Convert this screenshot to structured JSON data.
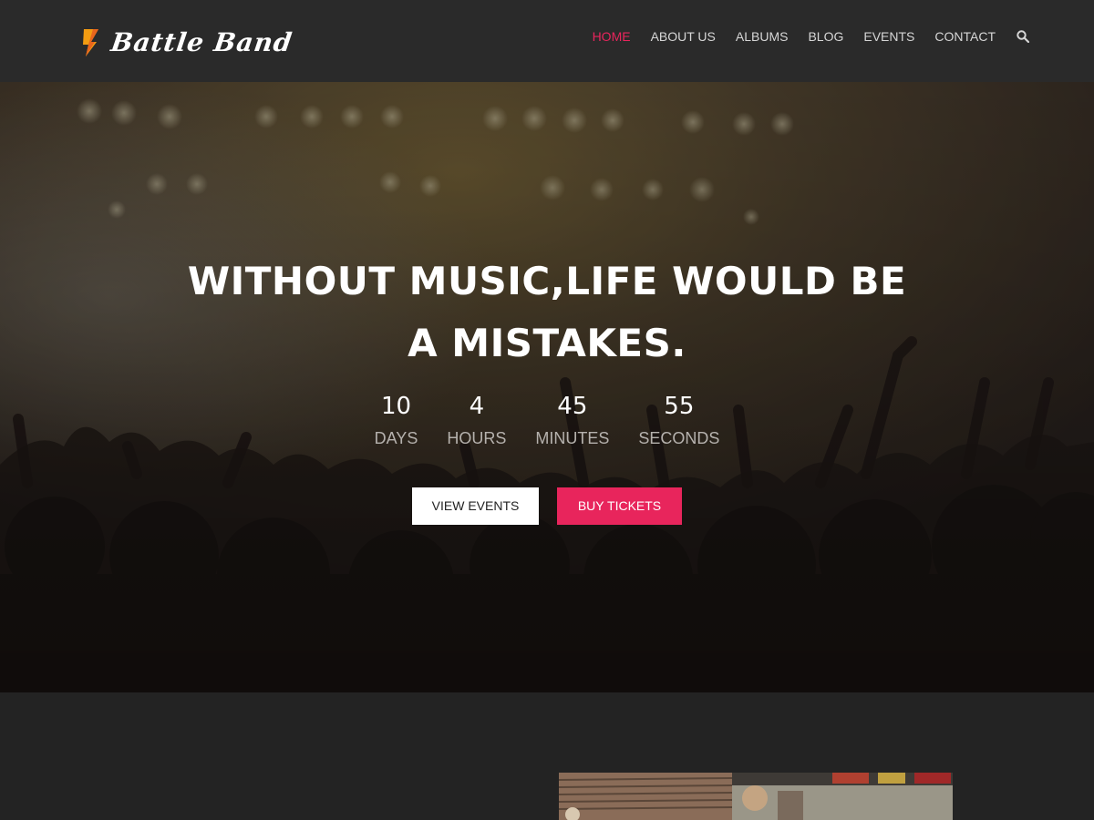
{
  "brand": {
    "name": "Battle Band",
    "accent_color": "#e8255c",
    "logo_color": "#f39c12",
    "logo_icon": "guitar-bolt-icon"
  },
  "nav": {
    "items": [
      {
        "label": "HOME",
        "active": true
      },
      {
        "label": "ABOUT US",
        "active": false
      },
      {
        "label": "ALBUMS",
        "active": false
      },
      {
        "label": "BLOG",
        "active": false
      },
      {
        "label": "EVENTS",
        "active": false
      },
      {
        "label": "CONTACT",
        "active": false
      }
    ],
    "search_icon": "search-icon"
  },
  "hero": {
    "title_line1": "WITHOUT MUSIC,LIFE WOULD BE",
    "title_line2": "A MISTAKES.",
    "countdown": [
      {
        "value": "10",
        "label": "DAYS"
      },
      {
        "value": "4",
        "label": "HOURS"
      },
      {
        "value": "45",
        "label": "MINUTES"
      },
      {
        "value": "55",
        "label": "SECONDS"
      }
    ],
    "buttons": {
      "view_events": "VIEW EVENTS",
      "buy_tickets": "BUY TICKETS"
    }
  }
}
